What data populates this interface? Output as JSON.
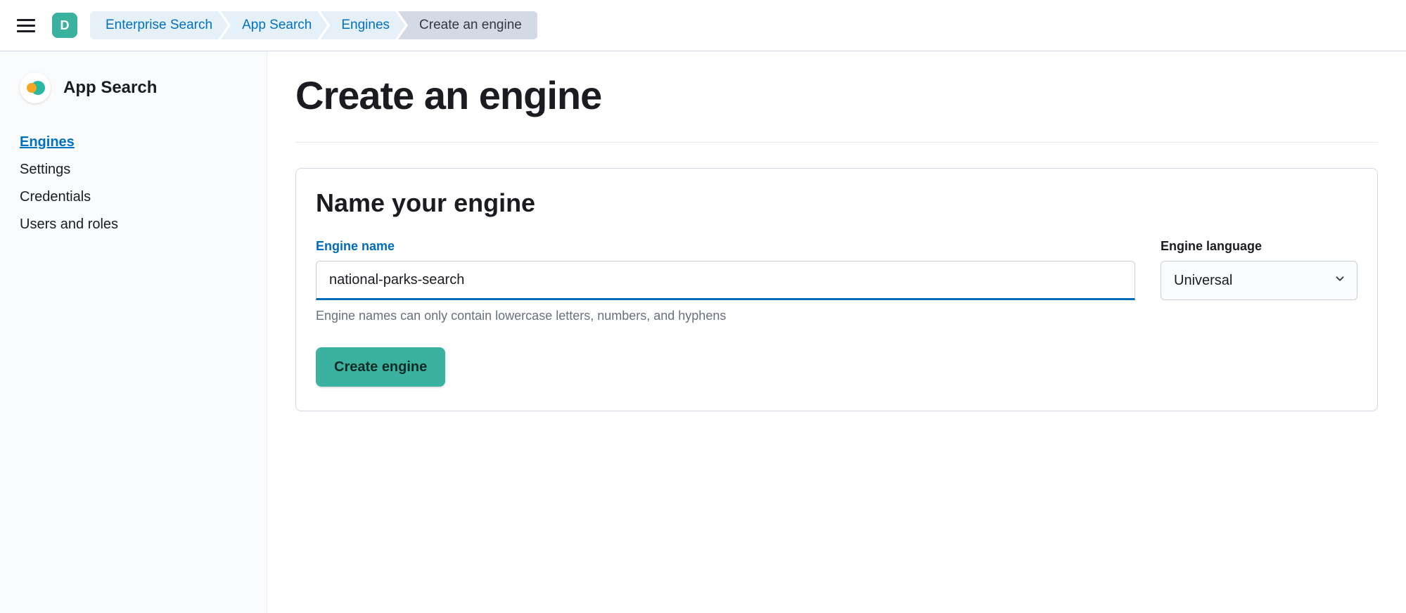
{
  "topbar": {
    "avatar_initial": "D",
    "breadcrumbs": [
      {
        "label": "Enterprise Search",
        "current": false
      },
      {
        "label": "App Search",
        "current": false
      },
      {
        "label": "Engines",
        "current": false
      },
      {
        "label": "Create an engine",
        "current": true
      }
    ]
  },
  "sidebar": {
    "title": "App Search",
    "items": [
      {
        "label": "Engines",
        "active": true
      },
      {
        "label": "Settings",
        "active": false
      },
      {
        "label": "Credentials",
        "active": false
      },
      {
        "label": "Users and roles",
        "active": false
      }
    ]
  },
  "main": {
    "page_title": "Create an engine",
    "panel_title": "Name your engine",
    "engine_name": {
      "label": "Engine name",
      "value": "national-parks-search",
      "help": "Engine names can only contain lowercase letters, numbers, and hyphens"
    },
    "engine_language": {
      "label": "Engine language",
      "selected": "Universal"
    },
    "submit_label": "Create engine"
  }
}
